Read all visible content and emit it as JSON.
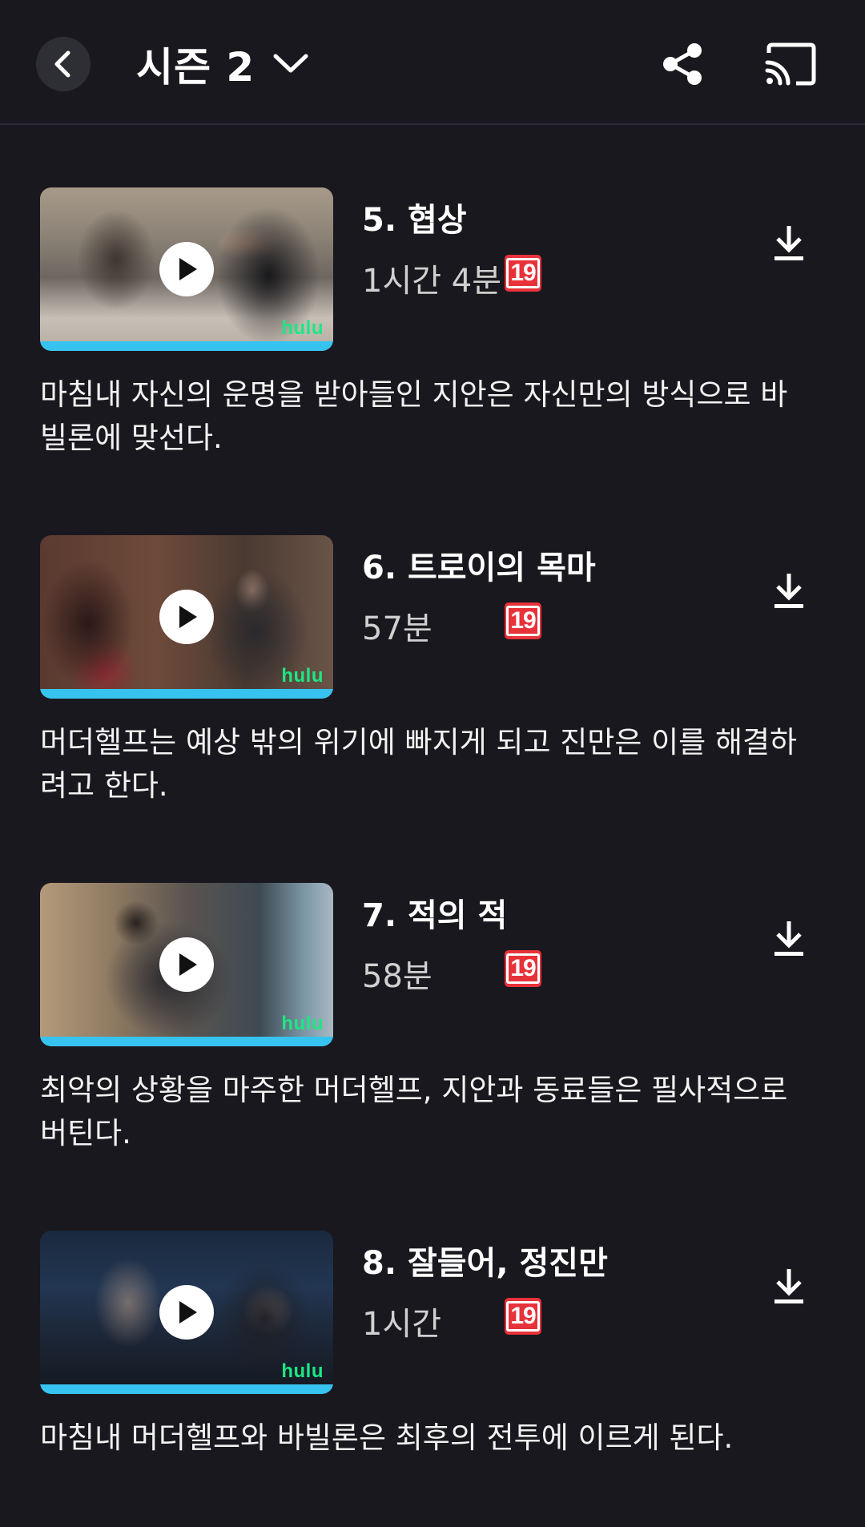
{
  "header": {
    "season_label": "시즌 2",
    "icons": {
      "back": "chevron-left-icon",
      "dropdown": "chevron-down-icon",
      "share": "share-icon",
      "cast": "cast-icon"
    }
  },
  "episodes": [
    {
      "title": "5. 협상",
      "runtime": "1시간 4분",
      "rating": "19",
      "watched_fraction": 1.0,
      "brand": "hulu",
      "description": "마침내 자신의 운명을 받아들인 지안은 자신만의 방식으로 바빌론에 맞선다."
    },
    {
      "title": "6. 트로이의 목마",
      "runtime": "57분",
      "rating": "19",
      "watched_fraction": 1.0,
      "brand": "hulu",
      "description": "머더헬프는 예상 밖의 위기에 빠지게 되고 진만은 이를 해결하려고 한다."
    },
    {
      "title": "7. 적의 적",
      "runtime": "58분",
      "rating": "19",
      "watched_fraction": 1.0,
      "brand": "hulu",
      "description": "최악의 상황을 마주한 머더헬프, 지안과 동료들은 필사적으로 버틴다."
    },
    {
      "title": "8. 잘들어, 정진만",
      "runtime": "1시간",
      "rating": "19",
      "watched_fraction": 1.0,
      "brand": "hulu",
      "description": "마침내 머더헬프와 바빌론은 최후의 전투에 이르게 된다."
    }
  ],
  "colors": {
    "background": "#18181e",
    "progress": "#37c3f0",
    "rating_badge": "#e8323a",
    "hulu_brand": "#1ce783"
  }
}
